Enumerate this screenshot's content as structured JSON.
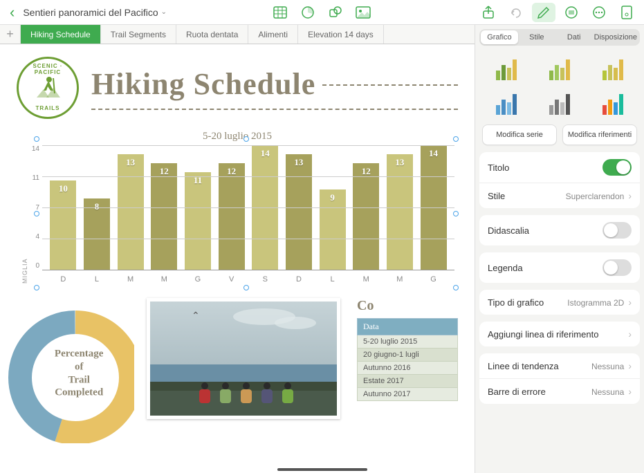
{
  "doc_title": "Sentieri panoramici del Pacifico",
  "sheet_tabs": [
    "Hiking Schedule",
    "Trail Segments",
    "Ruota dentata",
    "Alimenti",
    "Elevation 14 days"
  ],
  "page_heading": "Hiking Schedule",
  "badge": {
    "top": "SCENIC · PACIFIC",
    "bottom": "TRAILS"
  },
  "chart_data": {
    "type": "bar",
    "title": "5-20 luglio 2015",
    "ylabel": "MIGLIA",
    "ylim": [
      0,
      14
    ],
    "yticks": [
      14,
      11,
      7,
      4,
      0
    ],
    "categories": [
      "D",
      "L",
      "M",
      "M",
      "G",
      "V",
      "S",
      "D",
      "L",
      "M",
      "M",
      "G"
    ],
    "values": [
      10,
      8,
      13,
      12,
      11,
      12,
      14,
      13,
      9,
      12,
      13,
      14
    ],
    "colors": [
      "#c9c57c",
      "#a6a15c",
      "#c9c57c",
      "#a6a15c",
      "#c9c57c",
      "#a6a15c",
      "#c9c57c",
      "#a6a15c",
      "#c9c57c",
      "#a6a15c",
      "#c9c57c",
      "#a6a15c"
    ]
  },
  "donut": {
    "text_lines": [
      "Percentage",
      "of",
      "Trail",
      "Completed"
    ],
    "slices": [
      {
        "color": "#e8c265",
        "pct": 55
      },
      {
        "color": "#7ca9c0",
        "pct": 45
      }
    ]
  },
  "mini_table": {
    "corner_title": "Co",
    "header": "Data",
    "rows": [
      "5-20 luglio 2015",
      "20 giugno-1 lugli",
      "Autunno 2016",
      "Estate 2017",
      "Autunno 2017"
    ]
  },
  "inspector": {
    "tabs": [
      "Grafico",
      "Stile",
      "Dati",
      "Disposizione"
    ],
    "active_tab": 0,
    "modify_series": "Modifica serie",
    "modify_refs": "Modifica riferimenti",
    "title_label": "Titolo",
    "title_on": true,
    "style_label": "Stile",
    "style_value": "Superclarendon",
    "caption_label": "Didascalia",
    "caption_on": false,
    "legend_label": "Legenda",
    "legend_on": false,
    "charttype_label": "Tipo di grafico",
    "charttype_value": "Istogramma 2D",
    "refline_label": "Aggiungi linea di riferimento",
    "trend_label": "Linee di tendenza",
    "trend_value": "Nessuna",
    "error_label": "Barre di errore",
    "error_value": "Nessuna"
  }
}
